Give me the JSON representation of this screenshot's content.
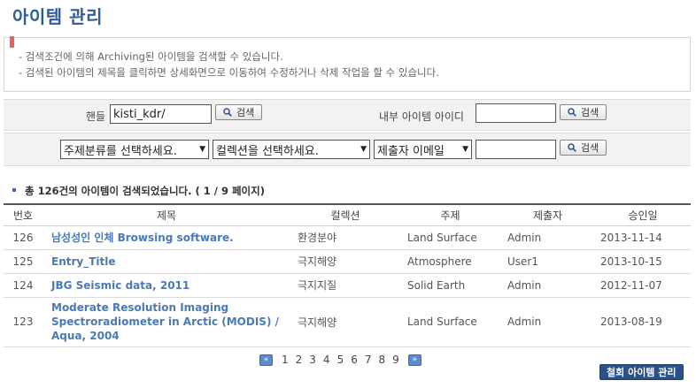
{
  "page": {
    "title": "아이템 관리"
  },
  "notice": {
    "line1": "- 검색조건에 의해 Archiving된 아이템을 검색할 수 있습니다.",
    "line2": "- 검색된 아이템의 제목을 클릭하면 상세화면으로 이동하여 수정하거나 삭제 작업을 할 수 있습니다."
  },
  "search": {
    "handle_label": "핸들",
    "handle_value": "kisti_kdr/",
    "internal_id_label": "내부 아이템 아이디",
    "internal_id_value": "",
    "button_label": "검색",
    "subject_select": "주제분류를 선택하세요.",
    "collection_select": "컬렉션을 선택하세요.",
    "submitter_select": "제출자 이메일",
    "submitter_value": ""
  },
  "results": {
    "summary": "총 126건의 아이템이 검색되었습니다. ( 1 / 9 페이지)",
    "columns": [
      "번호",
      "제목",
      "컬렉션",
      "주제",
      "제출자",
      "승인일"
    ],
    "rows": [
      {
        "num": "126",
        "title": "남성성인 인체 Browsing software.",
        "collection": "환경분야",
        "subject": "Land Surface",
        "submitter": "Admin",
        "date": "2013-11-14"
      },
      {
        "num": "125",
        "title": "Entry_Title",
        "collection": "극지해양",
        "subject": "Atmosphere",
        "submitter": "User1",
        "date": "2013-10-15"
      },
      {
        "num": "124",
        "title": "JBG Seismic data, 2011",
        "collection": "극지지질",
        "subject": "Solid Earth",
        "submitter": "Admin",
        "date": "2012-11-07"
      },
      {
        "num": "123",
        "title": "Moderate Resolution Imaging Spectroradiometer in Arctic (MODIS) / Aqua, 2004",
        "collection": "극지해양",
        "subject": "Land Surface",
        "submitter": "Admin",
        "date": "2013-08-19"
      }
    ]
  },
  "pagination": {
    "prev": "«",
    "next": "»",
    "pages": [
      "1",
      "2",
      "3",
      "4",
      "5",
      "6",
      "7",
      "8",
      "9"
    ]
  },
  "actions": {
    "withdrawn_button": "철회 아이템 관리"
  },
  "colors": {
    "title": "#2e5d9a",
    "link": "#4a79b9",
    "button_dark": "#2a5288",
    "pager": "#5b8ad0"
  }
}
